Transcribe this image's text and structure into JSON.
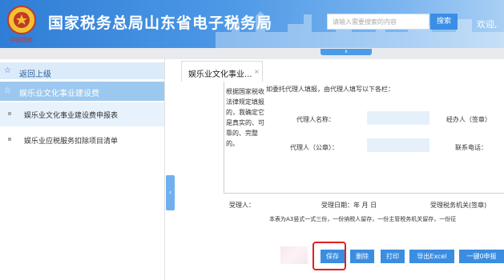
{
  "header": {
    "emblem_text": "中国税务",
    "title": "国家税务总局山东省电子税务局",
    "search_placeholder": "请输入需要搜索的内容",
    "search_button": "搜索",
    "welcome": "欢迎,",
    "toggle": "∧"
  },
  "sidebar": {
    "back": "返回上级",
    "group": "娱乐业文化事业建设费",
    "items": [
      {
        "label": "娱乐业文化事业建设费申报表"
      },
      {
        "label": "娱乐业应税服务扣除项目清单"
      }
    ],
    "collapse": "‹"
  },
  "tab": {
    "label": "娱乐业文化事业...",
    "close": "×"
  },
  "form": {
    "side_note": "根据国家税收法律规定填报的，我确定它是真实的、可靠的、完整的。",
    "agent_note": "如委托代理人填报，由代理人填写以下各栏：",
    "agent_name": "代理人名称：",
    "handler": "经办人（签章）",
    "agent_seal": "代理人（公章）：",
    "phone": "联系电话：",
    "receiver": "受理人：",
    "receive_date": "受理日期：年 月 日",
    "tax_office": "受理税务机关(签章)",
    "footnote": "本表为A3竖式一式三份，一份纳税人留存，一份主管税务机关留存，一份征"
  },
  "buttons": {
    "save": "保存",
    "delete": "删除",
    "print": "打印",
    "export": "导出Excel",
    "zero": "一键0申报"
  },
  "colors": {
    "header_blue": "#2f7dd6",
    "button_blue": "#3b8de0",
    "highlight_red": "#e0201d"
  }
}
